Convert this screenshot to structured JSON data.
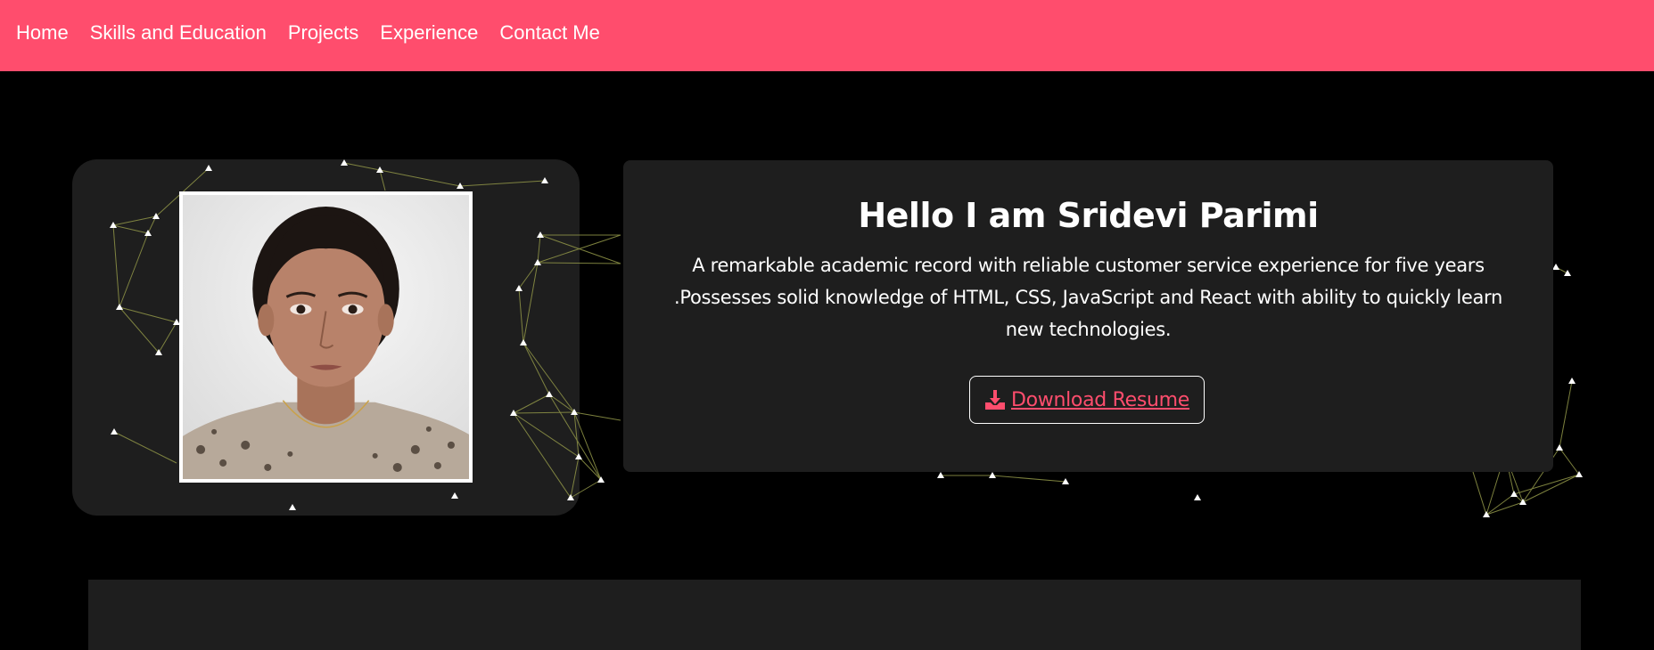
{
  "nav": {
    "items": [
      {
        "label": "Home"
      },
      {
        "label": "Skills and Education"
      },
      {
        "label": "Projects"
      },
      {
        "label": "Experience"
      },
      {
        "label": "Contact Me"
      }
    ]
  },
  "hero": {
    "title": "Hello I am Sridevi Parimi",
    "description": "A remarkable academic record with reliable customer service experience for five years .Possesses solid knowledge of HTML, CSS, JavaScript and React with ability to quickly learn new technologies.",
    "resume_button": {
      "label": " Download Resume",
      "icon": "download-icon"
    }
  },
  "colors": {
    "navbar": "#ff4d6d",
    "accent": "#ff4d6d",
    "card": "#1e1e1e",
    "background": "#000000",
    "particle_line": "#8a8f45",
    "particle_dot": "#ffffff"
  }
}
